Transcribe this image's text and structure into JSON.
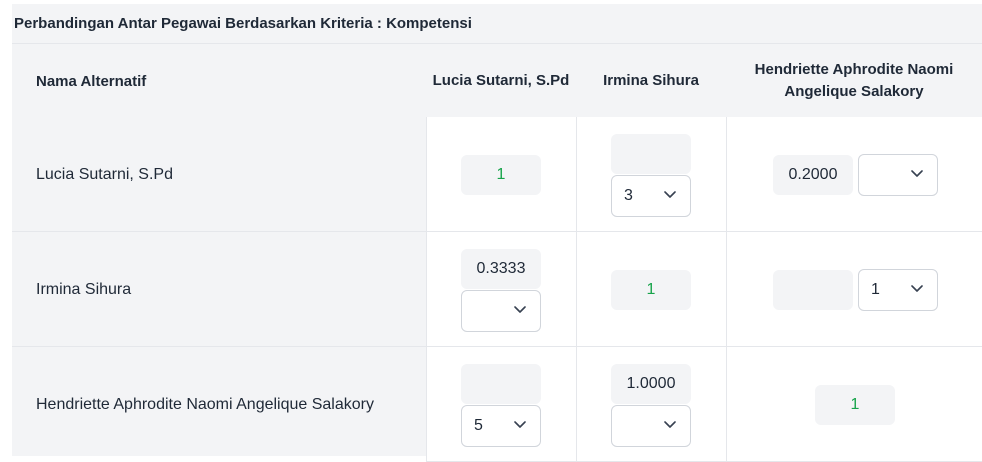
{
  "title": "Perbandingan Antar Pegawai Berdasarkan Kriteria : Kompetensi",
  "headers": {
    "name": "Nama Alternatif",
    "col1": "Lucia Sutarni, S.Pd",
    "col2": "Irmina Sihura",
    "col3": "Hendriette Aphrodite Naomi Angelique Salakory"
  },
  "rows": [
    {
      "label": "Lucia Sutarni, S.Pd",
      "cells": [
        {
          "value": "1"
        },
        {
          "value": "",
          "select": "3"
        },
        {
          "value": "0.2000",
          "select": ""
        }
      ]
    },
    {
      "label": "Irmina Sihura",
      "cells": [
        {
          "value": "0.3333",
          "select": ""
        },
        {
          "value": "1"
        },
        {
          "value": "",
          "select": "1"
        }
      ]
    },
    {
      "label": "Hendriette Aphrodite Naomi Angelique Salakory",
      "cells": [
        {
          "value": "",
          "select": "5"
        },
        {
          "value": "1.0000",
          "select": ""
        },
        {
          "value": "1"
        }
      ]
    }
  ],
  "colors": {
    "diagonal": "#16a34a",
    "panel_bg": "#f3f4f6"
  },
  "icons": {
    "dropdown": "chevron-down-icon"
  }
}
